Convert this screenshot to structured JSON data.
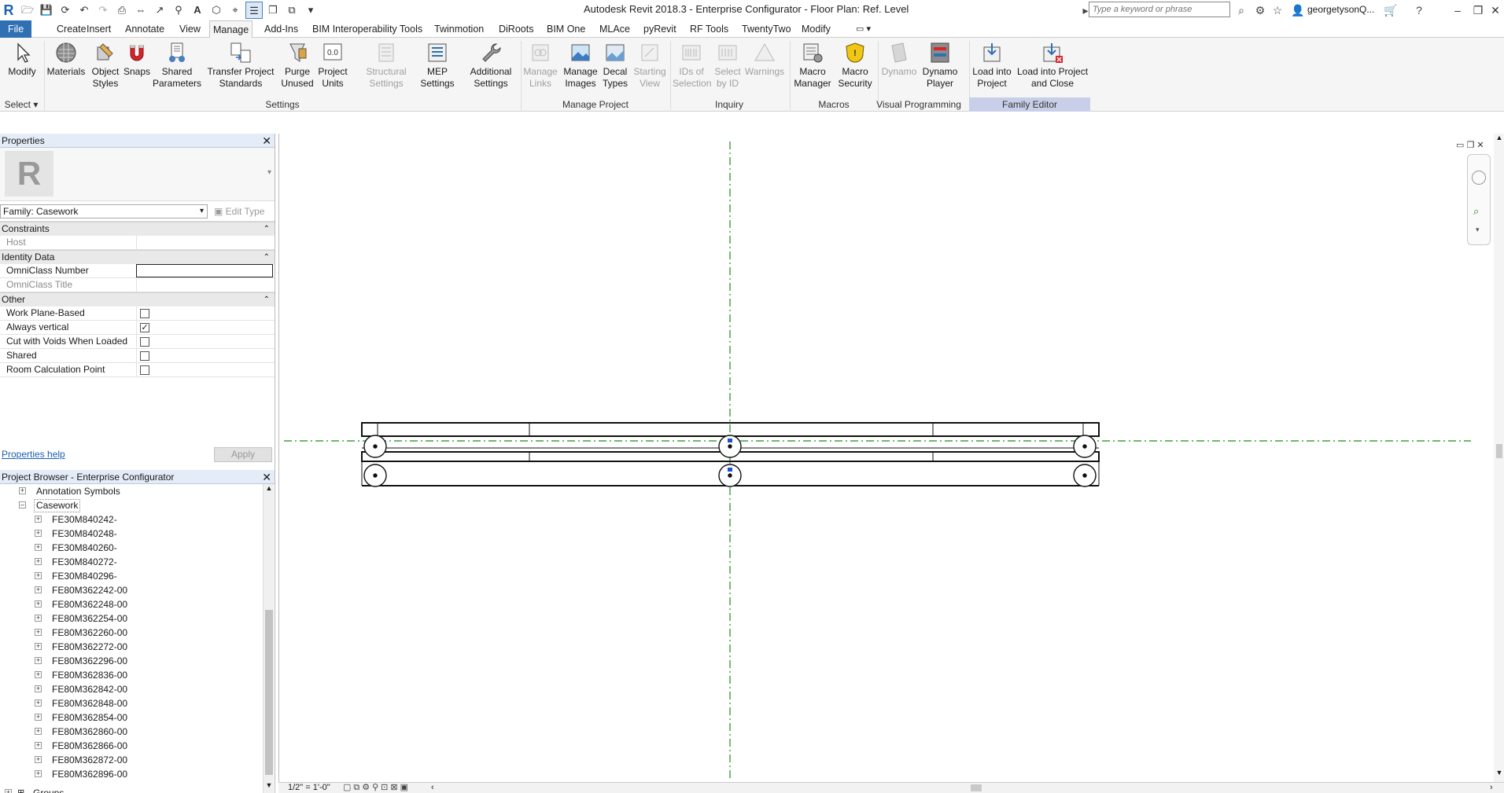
{
  "titlebar": {
    "app_logo": "R",
    "title": "Autodesk Revit 2018.3 -   Enterprise Configurator - Floor Plan: Ref. Level",
    "search_placeholder": "Type a keyword or phrase",
    "user": "georgetysonQ..."
  },
  "tabs": [
    "File",
    "Create",
    "Insert",
    "Annotate",
    "View",
    "Manage",
    "Add-Ins",
    "BIM Interoperability Tools",
    "Twinmotion",
    "DiRoots",
    "BIM One",
    "MLAce",
    "pyRevit",
    "RF Tools",
    "TwentyTwo",
    "Modify"
  ],
  "ribbon": {
    "select_label": "Select",
    "buttons": {
      "modify": "Modify",
      "materials": "Materials",
      "object_styles": "Object Styles",
      "snaps": "Snaps",
      "shared_parameters": "Shared Parameters",
      "transfer_project_standards": "Transfer Project Standards",
      "purge_unused": "Purge Unused",
      "project_units": "Project Units",
      "structural_settings": "Structural Settings",
      "mep_settings": "MEP Settings",
      "additional_settings": "Additional Settings",
      "manage_links": "Manage Links",
      "manage_images": "Manage Images",
      "decal_types": "Decal Types",
      "starting_view": "Starting View",
      "ids_of_selection": "IDs of Selection",
      "select_by_id": "Select by ID",
      "warnings": "Warnings",
      "macro_manager": "Macro Manager",
      "macro_security": "Macro Security",
      "dynamo": "Dynamo",
      "dynamo_player": "Dynamo Player",
      "load_into_project": "Load into Project",
      "load_into_project_and_close": "Load into Project and Close"
    },
    "panels": {
      "settings": "Settings",
      "manage_project": "Manage Project",
      "inquiry": "Inquiry",
      "macros": "Macros",
      "visual_programming": "Visual Programming",
      "family_editor": "Family Editor"
    }
  },
  "properties": {
    "title": "Properties",
    "type_selector": "Family: Casework",
    "edit_type": "Edit Type",
    "help_link": "Properties help",
    "apply": "Apply",
    "categories": {
      "constraints": "Constraints",
      "identity": "Identity Data",
      "other": "Other"
    },
    "rows": {
      "host": "Host",
      "omniclass_number": "OmniClass Number",
      "omniclass_title": "OmniClass Title",
      "work_plane_based": "Work Plane-Based",
      "always_vertical": "Always vertical",
      "cut_with_voids": "Cut with Voids When Loaded",
      "shared": "Shared",
      "room_calc_point": "Room Calculation Point"
    },
    "checked": {
      "work_plane_based": false,
      "always_vertical": true,
      "cut_with_voids": false,
      "shared": false,
      "room_calc_point": false
    }
  },
  "browser": {
    "title": "Project Browser - Enterprise Configurator",
    "annotation_symbols": "Annotation Symbols",
    "casework": "Casework",
    "items": [
      "FE30M840242-",
      "FE30M840248-",
      "FE30M840260-",
      "FE30M840272-",
      "FE30M840296-",
      "FE80M362242-00",
      "FE80M362248-00",
      "FE80M362254-00",
      "FE80M362260-00",
      "FE80M362272-00",
      "FE80M362296-00",
      "FE80M362836-00",
      "FE80M362842-00",
      "FE80M362848-00",
      "FE80M362854-00",
      "FE80M362860-00",
      "FE80M362866-00",
      "FE80M362872-00",
      "FE80M362896-00"
    ],
    "groups": "Groups"
  },
  "statusbar": {
    "scale": "1/2\" = 1'-0\""
  },
  "colors": {
    "accent": "#2f6fb3",
    "ref_plane": "#1f8a1f",
    "family_editor_panel": "#c9cfe9"
  }
}
